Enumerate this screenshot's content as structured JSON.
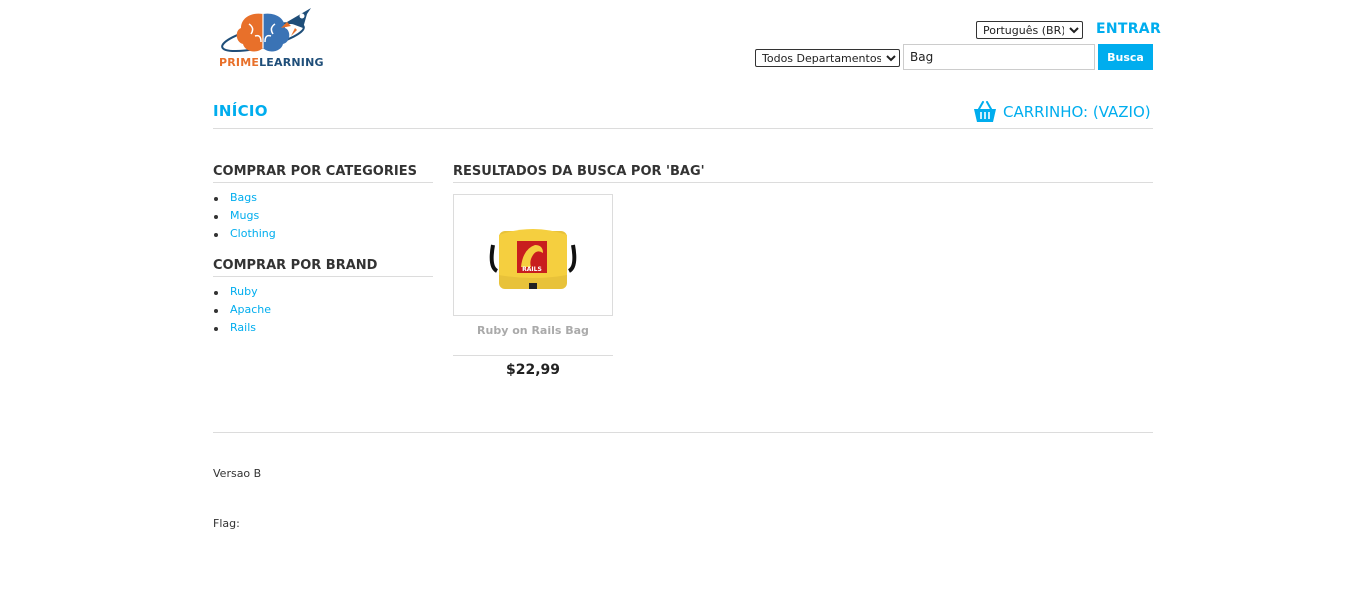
{
  "header": {
    "logo": {
      "text_part1": "PRIME",
      "text_part2": "LEARNING"
    },
    "language": {
      "selected": "Português (BR)"
    },
    "login_label": "ENTRAR",
    "search": {
      "department": "Todos Departamentos",
      "query": "Bag",
      "button_label": "Busca"
    }
  },
  "nav": {
    "home_label": "INÍCIO",
    "cart_label": "CARRINHO: (VAZIO)"
  },
  "sidebar": {
    "categories": {
      "title": "COMPRAR POR CATEGORIES",
      "items": [
        {
          "label": "Bags"
        },
        {
          "label": "Mugs"
        },
        {
          "label": "Clothing"
        }
      ]
    },
    "brands": {
      "title": "COMPRAR POR BRAND",
      "items": [
        {
          "label": "Ruby"
        },
        {
          "label": "Apache"
        },
        {
          "label": "Rails"
        }
      ]
    }
  },
  "results": {
    "title": "RESULTADOS DA BUSCA POR 'BAG'",
    "products": [
      {
        "name": "Ruby on Rails Bag",
        "price": "$22,99",
        "image_text": "RAILS"
      }
    ]
  },
  "footer": {
    "version": "Versao B",
    "flag": "Flag:"
  },
  "colors": {
    "accent": "#00adee",
    "logo_orange": "#e8702a",
    "logo_blue": "#1f4e79"
  }
}
